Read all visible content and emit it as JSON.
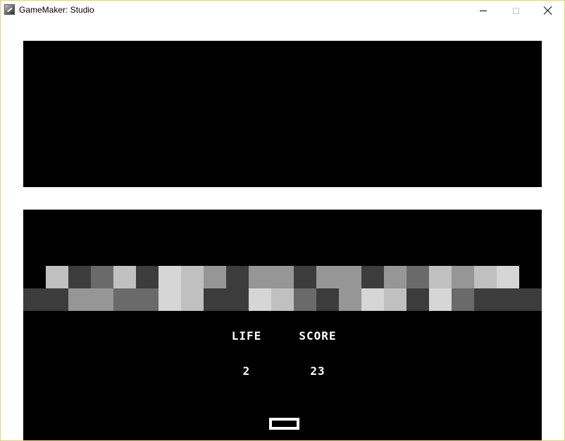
{
  "window": {
    "title": "GameMaker: Studio",
    "icon": "gamemaker-icon",
    "controls": [
      "minimize-icon",
      "maximize-icon",
      "close-icon"
    ]
  },
  "hud": {
    "life_label": "LIFE",
    "score_label": "SCORE",
    "life_value": "2",
    "score_value": "23"
  },
  "bricks": {
    "row_top": [
      "#c0c0c0",
      "#3c3c3c",
      "#6a6a6a",
      "#c0c0c0",
      "#3c3c3c",
      "#d6d6d6",
      "#c0c0c0",
      "#969696",
      "#3c3c3c",
      "#969696",
      "#969696",
      "#3c3c3c",
      "#969696",
      "#969696",
      "#3c3c3c",
      "#969696",
      "#6a6a6a",
      "#c0c0c0",
      "#969696",
      "#c0c0c0",
      "#d6d6d6"
    ],
    "row_bottom": [
      "#3c3c3c",
      "#3c3c3c",
      "#969696",
      "#969696",
      "#6a6a6a",
      "#6a6a6a",
      "#d6d6d6",
      "#c0c0c0",
      "#3c3c3c",
      "#3c3c3c",
      "#d6d6d6",
      "#c0c0c0",
      "#6a6a6a",
      "#3c3c3c",
      "#969696",
      "#d6d6d6",
      "#c0c0c0",
      "#3c3c3c",
      "#d6d6d6",
      "#6a6a6a",
      "#3c3c3c",
      "#3c3c3c",
      "#3c3c3c"
    ]
  },
  "colors": {
    "playfield": "#000000",
    "window_border": "#e8d26a",
    "paddle": "#ffffff"
  }
}
